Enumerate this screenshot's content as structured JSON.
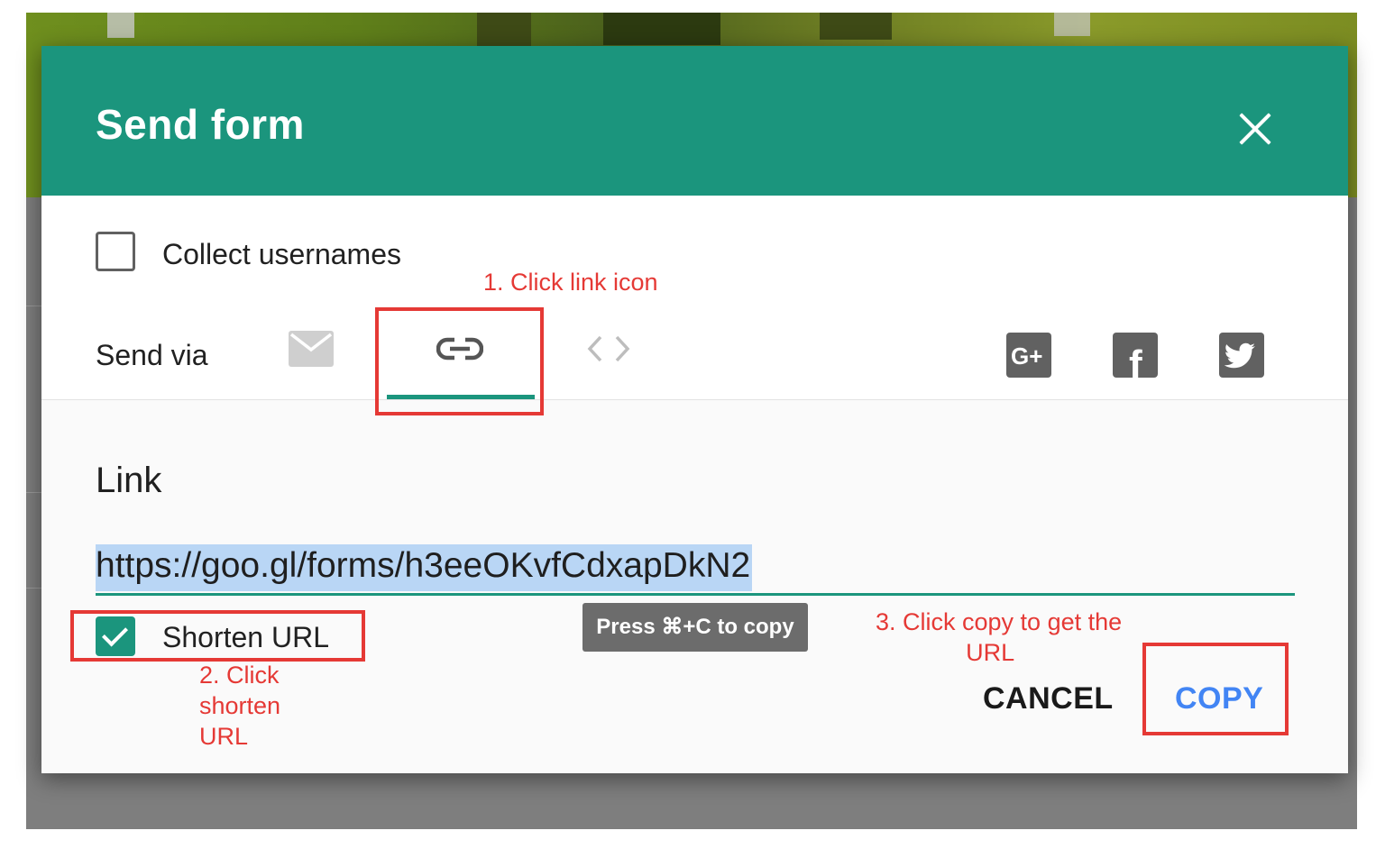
{
  "dialog": {
    "title": "Send form",
    "close_icon": "close-icon"
  },
  "options": {
    "collect_usernames_label": "Collect usernames",
    "collect_usernames_checked": false
  },
  "send_via": {
    "label": "Send via",
    "tabs": [
      {
        "icon": "mail-icon",
        "active": false
      },
      {
        "icon": "link-icon",
        "active": true
      },
      {
        "icon": "code-embed-icon",
        "active": false
      }
    ],
    "social": [
      {
        "icon": "google-plus-icon",
        "text": "G+"
      },
      {
        "icon": "facebook-icon",
        "text": "f"
      },
      {
        "icon": "twitter-icon"
      }
    ]
  },
  "link": {
    "heading": "Link",
    "url": "https://goo.gl/forms/h3eeOKvfCdxapDkN2",
    "shorten_label": "Shorten URL",
    "shorten_checked": true,
    "tooltip": "Press ⌘+C to copy"
  },
  "actions": {
    "cancel": "CANCEL",
    "copy": "COPY"
  },
  "annotations": {
    "step1": "1. Click link icon",
    "step2_lines": [
      "2. Click",
      "shorten",
      "URL"
    ],
    "step3_lines": [
      "3. Click copy to get the",
      "URL"
    ]
  },
  "colors": {
    "header": "#1b957d",
    "accent": "#1b957d",
    "copy_button": "#4285f4",
    "annotation": "#e53935",
    "selection": "#b9d6f5"
  }
}
